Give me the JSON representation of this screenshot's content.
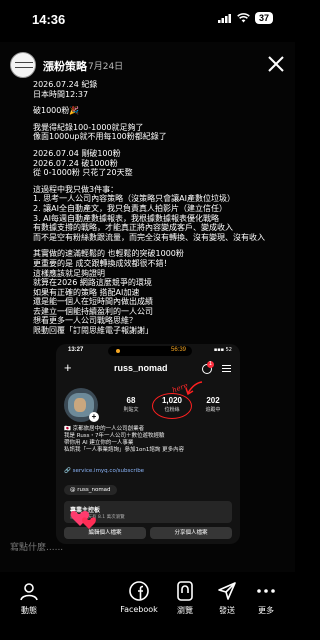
{
  "status_bar": {
    "time": "14:36",
    "battery": "37"
  },
  "header": {
    "account_name": "漲粉策略",
    "date": "7月24日"
  },
  "post": {
    "lines": [
      "2026.07.24 紀錄",
      "日本時間12:37",
      "",
      "破1000粉🎉",
      "",
      "我覺得紀錄100-1000就足夠了",
      "像面1000up就不用每100粉都紀錄了",
      "",
      "2026.07.04 剛破100粉",
      "2026.07.24 破1000粉",
      "從 0-1000粉 只花了20天整",
      "",
      "這過程中我只做3件事：",
      "1. 思考一人公司內容策略（沒策略只會讓AI產數位垃圾）",
      "2. 讓AI全自動產文，我只負責真人拍影片（建立信任）",
      "3. AI每週自動產數據報表，我根據數據報表優化戰略",
      "有數據支撐的戰略，才能真正將內容變成客戶、變成收入",
      "而不是空有粉絲數跟流量，而完全沒有轉換、沒有變現、沒有收入",
      "",
      "其實做的速滿輕鬆的 也輕鬆的突破1000粉",
      "更重要的是 成交跟轉換成效都很不錯！",
      "這樣應該就足夠證明",
      "就算在2026 網路這麼競爭的環境",
      "如果有正確的策略 搭配AI加速",
      "還是能一個人在短時間內做出成績",
      "去建立一個能持續盈利的一人公司",
      "想看更多一人公司戰略思維？",
      "限動回覆「訂閱思維電子報謝謝」"
    ]
  },
  "embedded": {
    "time": "13:27",
    "island_time": "56:39",
    "status_right": "▪▪▪ 52",
    "username": "russ_nomad",
    "threads_badge": "1",
    "stats": [
      {
        "value": "68",
        "label": "則貼文"
      },
      {
        "value": "1,020",
        "label": "位粉絲"
      },
      {
        "value": "202",
        "label": "追蹤中"
      }
    ],
    "annotation": "here",
    "bio": "🇯🇵 京都旅居中的一人公司創業者\n我是 Russ・7年一人公司＋數位遊牧經驗\n帶你用 AI 建立你的一人事業\n私訊我「一人事業諮詢」參加1on1諮詢 更多內容",
    "link": "🔗 service.imyq.co/subscribe",
    "threads_chip": "@ russ_nomad",
    "dashboard_title": "專業主控板",
    "dashboard_sub": "過去 30 天有 8.1 萬次瀏覽",
    "btn_left": "編輯個人檔案",
    "btn_right": "分享個人檔案"
  },
  "comment_placeholder": "寫點什麼......",
  "bottom_bar": [
    {
      "label": "動態",
      "icon": "activity-icon"
    },
    {
      "label": "Facebook",
      "icon": "facebook-icon"
    },
    {
      "label": "瀏覽",
      "icon": "browse-icon"
    },
    {
      "label": "發送",
      "icon": "send-icon"
    },
    {
      "label": "更多",
      "icon": "more-icon"
    }
  ]
}
